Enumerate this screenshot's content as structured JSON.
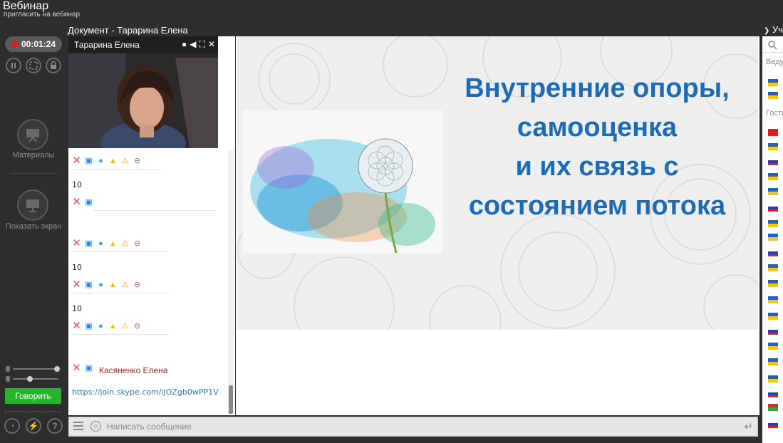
{
  "app": {
    "title": "Вебинар",
    "invite_link": "пригласить на вебинар"
  },
  "document": {
    "title": "Документ - Тарарина Елена"
  },
  "participants": {
    "title": "Участники",
    "sections": [
      "Ведущие",
      "Гости"
    ],
    "flags": [
      {
        "country": "ua",
        "colors": [
          "#1f5fc8",
          "#f3c51b"
        ]
      },
      {
        "country": "ua",
        "colors": [
          "#1f5fc8",
          "#f3c51b"
        ]
      },
      {
        "country": "tr",
        "colors": [
          "#e02020",
          "#e02020"
        ]
      },
      {
        "country": "ua",
        "colors": [
          "#1f5fc8",
          "#f3c51b"
        ]
      },
      {
        "country": "ru",
        "colors": [
          "#ffffff",
          "#2040c0",
          "#e02020"
        ]
      },
      {
        "country": "ua",
        "colors": [
          "#1f5fc8",
          "#f3c51b"
        ]
      },
      {
        "country": "ua",
        "colors": [
          "#1f5fc8",
          "#f3c51b"
        ]
      },
      {
        "country": "ru",
        "colors": [
          "#ffffff",
          "#2040c0",
          "#e02020"
        ]
      },
      {
        "country": "ua",
        "colors": [
          "#1f5fc8",
          "#f3c51b"
        ]
      },
      {
        "country": "ua",
        "colors": [
          "#1f5fc8",
          "#f3c51b"
        ]
      },
      {
        "country": "ru",
        "colors": [
          "#ffffff",
          "#2040c0",
          "#e02020"
        ]
      },
      {
        "country": "ua",
        "colors": [
          "#1f5fc8",
          "#f3c51b"
        ]
      },
      {
        "country": "ua",
        "colors": [
          "#1f5fc8",
          "#f3c51b"
        ]
      },
      {
        "country": "ua",
        "colors": [
          "#1f5fc8",
          "#f3c51b"
        ]
      },
      {
        "country": "ua",
        "colors": [
          "#1f5fc8",
          "#f3c51b"
        ]
      },
      {
        "country": "ru",
        "colors": [
          "#ffffff",
          "#2040c0",
          "#e02020"
        ]
      },
      {
        "country": "ua",
        "colors": [
          "#1f5fc8",
          "#f3c51b"
        ]
      },
      {
        "country": "ua",
        "colors": [
          "#1f5fc8",
          "#f3c51b"
        ]
      },
      {
        "country": "ua",
        "colors": [
          "#1f5fc8",
          "#f3c51b"
        ]
      },
      {
        "country": "ru",
        "colors": [
          "#ffffff",
          "#2040c0",
          "#e02020"
        ]
      },
      {
        "country": "by",
        "colors": [
          "#d52b2b",
          "#3aa03a"
        ]
      },
      {
        "country": "ru",
        "colors": [
          "#ffffff",
          "#2040c0",
          "#e02020"
        ]
      }
    ]
  },
  "toolbar": {
    "timer": "00:01:24",
    "materials_label": "Материалы",
    "share_screen_label": "Показать экран",
    "talk_button": "Говорить"
  },
  "video": {
    "name": "Тарарина Елена"
  },
  "chat": {
    "messages": [
      {
        "text": "10"
      },
      {
        "text": "10"
      },
      {
        "text": "10"
      }
    ],
    "last_sender": "Касяненко Елена",
    "link": "https://join.skype.com/iJOZgb0wPP1V"
  },
  "slide": {
    "title_lines": [
      "Внутренние опоры,",
      "самооценка",
      "и их связь с",
      "состоянием потока"
    ]
  },
  "input": {
    "placeholder": "Написать сообщение"
  },
  "colors": {
    "accent_green": "#24b52a",
    "slide_title": "#1c6bb5",
    "record_red": "#d61e1e"
  }
}
